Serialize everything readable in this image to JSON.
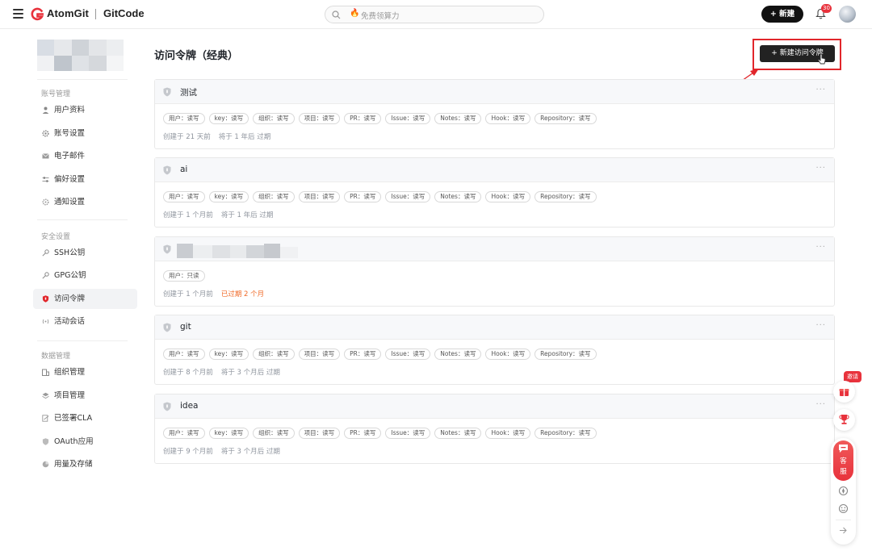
{
  "topbar": {
    "brand_primary": "AtomGit",
    "brand_secondary": "GitCode",
    "search_placeholder": "免费领算力",
    "new_button": "+ 新建",
    "notification_count": "30"
  },
  "sidebar": {
    "account_section": "账号管理",
    "account_items": [
      "用户资料",
      "账号设置",
      "电子邮件",
      "偏好设置",
      "通知设置"
    ],
    "security_section": "安全设置",
    "security_items": [
      "SSH公钥",
      "GPG公钥",
      "访问令牌",
      "活动会话"
    ],
    "data_section": "数据管理",
    "data_items": [
      "组织管理",
      "项目管理",
      "已签署CLA",
      "OAuth应用",
      "用量及存储"
    ],
    "active_item": "访问令牌"
  },
  "main": {
    "title": "访问令牌（经典）",
    "create_button": "+ 新建访问令牌",
    "tokens": [
      {
        "name": "测试",
        "scopes": [
          "用户：读写",
          "key：读写",
          "组织：读写",
          "项目：读写",
          "PR：读写",
          "Issue：读写",
          "Notes：读写",
          "Hook：读写",
          "Repository：读写"
        ],
        "created": "创建于 21 天前",
        "expiry": "将于 1 年后 过期",
        "expired": false
      },
      {
        "name": "ai",
        "scopes": [
          "用户：读写",
          "key：读写",
          "组织：读写",
          "项目：读写",
          "PR：读写",
          "Issue：读写",
          "Notes：读写",
          "Hook：读写",
          "Repository：读写"
        ],
        "created": "创建于 1 个月前",
        "expiry": "将于 1 年后 过期",
        "expired": false
      },
      {
        "name": "",
        "scopes": [
          "用户：只读"
        ],
        "created": "创建于 1 个月前",
        "expiry": "已过期 2 个月",
        "expired": true
      },
      {
        "name": "git",
        "scopes": [
          "用户：读写",
          "key：读写",
          "组织：读写",
          "项目：读写",
          "PR：读写",
          "Issue：读写",
          "Notes：读写",
          "Hook：读写",
          "Repository：读写"
        ],
        "created": "创建于 8 个月前",
        "expiry": "将于 3 个月后 过期",
        "expired": false
      },
      {
        "name": "idea",
        "scopes": [
          "用户：读写",
          "key：读写",
          "组织：读写",
          "项目：读写",
          "PR：读写",
          "Issue：读写",
          "Notes：读写",
          "Hook：读写",
          "Repository：读写"
        ],
        "created": "创建于 9 个月前",
        "expiry": "将于 3 个月后 过期",
        "expired": false
      }
    ],
    "more_label": "···"
  },
  "floating": {
    "invite_tag": "邀请",
    "service_label_1": "客",
    "service_label_2": "服"
  },
  "colors": {
    "accent": "#e1262b",
    "expired": "#f06a28",
    "brand_red": "#e8323c"
  }
}
